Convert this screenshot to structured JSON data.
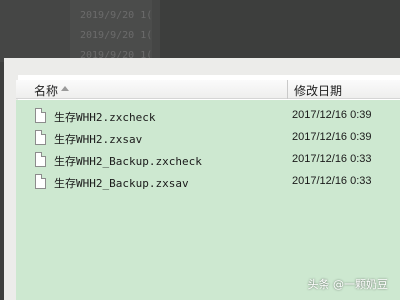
{
  "background_window": {
    "rows": [
      "2019/9/20 1(",
      "2019/9/20 1(",
      "2019/9/20 1("
    ]
  },
  "explorer": {
    "columns": {
      "name": "名称",
      "date": "修改日期"
    },
    "files": [
      {
        "name": "生存WHH2.zxcheck",
        "date": "2017/12/16 0:39"
      },
      {
        "name": "生存WHH2.zxsav",
        "date": "2017/12/16 0:39"
      },
      {
        "name": "生存WHH2_Backup.zxcheck",
        "date": "2017/12/16 0:33"
      },
      {
        "name": "生存WHH2_Backup.zxsav",
        "date": "2017/12/16 0:33"
      }
    ]
  },
  "colors": {
    "list_bg": "#cde8d0",
    "desktop_bg": "#3d3e3d"
  },
  "watermark": "头条 @一颗奶豆"
}
